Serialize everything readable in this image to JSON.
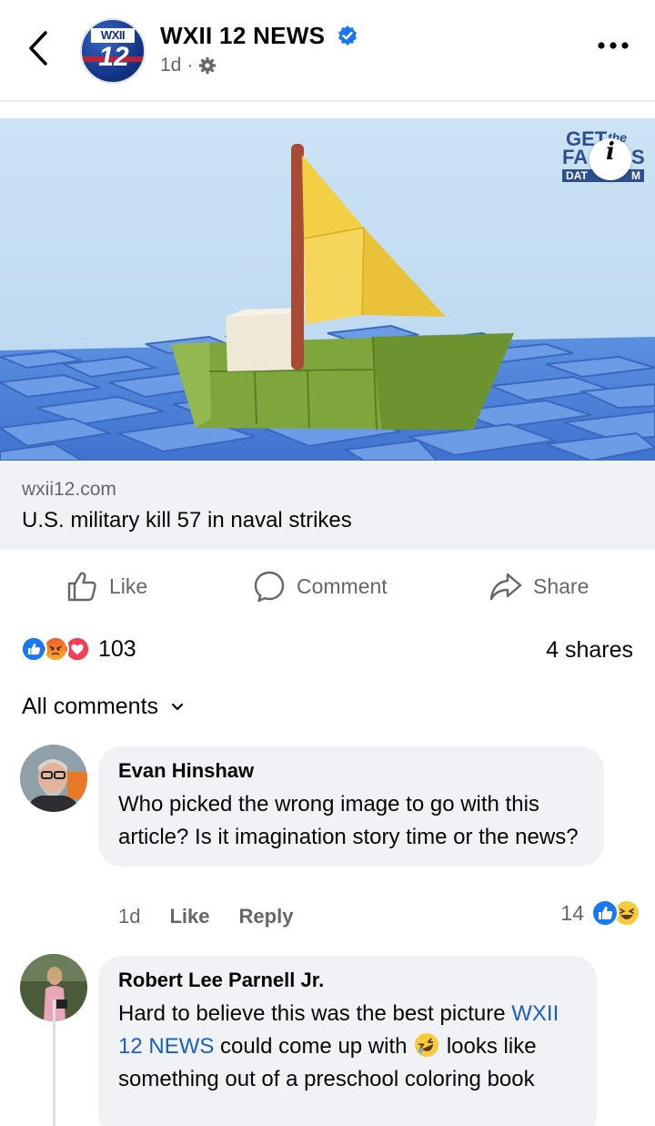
{
  "header": {
    "page_name": "WXII 12 NEWS",
    "time": "1d",
    "dot": "·",
    "logo_text": "WXII",
    "logo_number": "12"
  },
  "link_card": {
    "domain": "wxii12.com",
    "title": "U.S. military kill 57 in naval strikes",
    "watermark_line1": "GET",
    "watermark_line2": "the",
    "watermark_line3": "FA",
    "watermark_line4": "S",
    "watermark_line5": "DAT",
    "watermark_line6": "M",
    "info_label": "i"
  },
  "actions": {
    "like": "Like",
    "comment": "Comment",
    "share": "Share"
  },
  "stats": {
    "reaction_count": "103",
    "shares": "4 shares"
  },
  "comments_filter": "All comments",
  "comments": [
    {
      "name": "Evan Hinshaw",
      "text": "Who picked the wrong image to go with this article? Is it imagination story time or the news?",
      "time": "1d",
      "like": "Like",
      "reply": "Reply",
      "reaction_count": "14"
    },
    {
      "name": "Robert Lee Parnell Jr.",
      "text_before": "Hard to believe this was the best picture",
      "mention": "WXII 12 NEWS",
      "text_after": "could come up with",
      "text_end": "looks like something out of a preschool coloring book"
    }
  ],
  "colors": {
    "like_blue": "#1877f2",
    "love_red": "#f33e58",
    "angry_orange": "#e9710f",
    "meta_gray": "#65676b",
    "bubble_bg": "#f0f2f5",
    "mention_blue": "#1d5fbd"
  },
  "icons": [
    "back-chevron-icon",
    "verified-badge-icon",
    "gear-icon",
    "more-icon",
    "like-thumb-icon",
    "comment-icon",
    "share-icon",
    "chevron-down-icon"
  ]
}
